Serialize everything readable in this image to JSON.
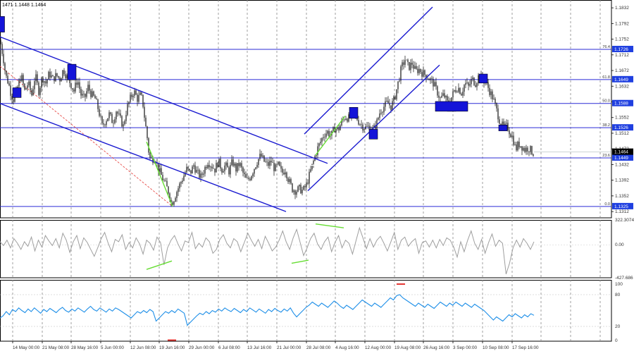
{
  "ohlc_header": "1471 1.1448 1.1464",
  "chart_data": [
    {
      "type": "candlestick",
      "title": "",
      "price_ticks": [
        "1.1832",
        "1.1792",
        "1.1752",
        "1.1712",
        "1.1672",
        "1.1632",
        "1.1592",
        "1.1552",
        "1.1512",
        "1.1472",
        "1.1432",
        "1.1392",
        "1.1352",
        "1.1312"
      ],
      "ylim": [
        1.1296,
        1.1852
      ],
      "x_ticks": [
        "14 May 00:00",
        "21 May 08:00",
        "28 May 16:00",
        "5 Jun 00:00",
        "12 Jun 08:00",
        "19 Jun 16:00",
        "29 Jun 00:00",
        "6 Jul 08:00",
        "13 Jul 16:00",
        "21 Jul 00:00",
        "28 Jul 08:00",
        "4 Aug 16:00",
        "12 Aug 00:00",
        "19 Aug 08:00",
        "26 Aug 16:00",
        "3 Sep 00:00",
        "10 Sep 08:00",
        "17 Sep 16:00"
      ],
      "fib_levels": [
        {
          "pct": "76.4",
          "price": "1.1726",
          "value": 1.1726
        },
        {
          "pct": "61.8",
          "price": "1.1649",
          "value": 1.1649
        },
        {
          "pct": "50.0",
          "price": "1.1588",
          "value": 1.1588
        },
        {
          "pct": "38.2",
          "price": "1.1526",
          "value": 1.1526
        },
        {
          "pct": "23.6",
          "price": "1.1449",
          "value": 1.1449
        },
        {
          "pct": "0.0",
          "price": "1.1325",
          "value": 1.1325
        }
      ],
      "current_price": "1.1464",
      "close_path": [
        [
          0,
          1.175
        ],
        [
          2,
          1.173
        ],
        [
          5,
          1.17
        ],
        [
          8,
          1.166
        ],
        [
          12,
          1.164
        ],
        [
          16,
          1.161
        ],
        [
          20,
          1.1595
        ],
        [
          25,
          1.163
        ],
        [
          30,
          1.166
        ],
        [
          35,
          1.162
        ],
        [
          40,
          1.164
        ],
        [
          45,
          1.161
        ],
        [
          50,
          1.166
        ],
        [
          55,
          1.162
        ],
        [
          60,
          1.1655
        ],
        [
          65,
          1.164
        ],
        [
          70,
          1.1665
        ],
        [
          75,
          1.165
        ],
        [
          80,
          1.166
        ],
        [
          85,
          1.165
        ],
        [
          90,
          1.1675
        ],
        [
          95,
          1.1655
        ],
        [
          100,
          1.164
        ],
        [
          105,
          1.162
        ],
        [
          110,
          1.165
        ],
        [
          115,
          1.161
        ],
        [
          120,
          1.16
        ],
        [
          125,
          1.163
        ],
        [
          130,
          1.161
        ],
        [
          135,
          1.16
        ],
        [
          140,
          1.157
        ],
        [
          145,
          1.153
        ],
        [
          150,
          1.1545
        ],
        [
          155,
          1.156
        ],
        [
          160,
          1.154
        ],
        [
          165,
          1.157
        ],
        [
          170,
          1.155
        ],
        [
          175,
          1.153
        ],
        [
          180,
          1.1575
        ],
        [
          185,
          1.16
        ],
        [
          190,
          1.162
        ],
        [
          195,
          1.16
        ],
        [
          200,
          1.161
        ],
        [
          203,
          1.1585
        ],
        [
          206,
          1.154
        ],
        [
          209,
          1.15
        ],
        [
          212,
          1.145
        ],
        [
          215,
          1.1445
        ],
        [
          220,
          1.145
        ],
        [
          225,
          1.142
        ],
        [
          230,
          1.14
        ],
        [
          235,
          1.138
        ],
        [
          240,
          1.136
        ],
        [
          243,
          1.1335
        ],
        [
          246,
          1.134
        ],
        [
          250,
          1.136
        ],
        [
          255,
          1.138
        ],
        [
          260,
          1.14
        ],
        [
          265,
          1.142
        ],
        [
          270,
          1.141
        ],
        [
          275,
          1.143
        ],
        [
          280,
          1.141
        ],
        [
          285,
          1.14
        ],
        [
          290,
          1.142
        ],
        [
          295,
          1.144
        ],
        [
          300,
          1.143
        ],
        [
          305,
          1.142
        ],
        [
          310,
          1.144
        ],
        [
          315,
          1.142
        ],
        [
          320,
          1.143
        ],
        [
          325,
          1.1415
        ],
        [
          330,
          1.144
        ],
        [
          335,
          1.142
        ],
        [
          340,
          1.1435
        ],
        [
          345,
          1.141
        ],
        [
          350,
          1.139
        ],
        [
          355,
          1.14
        ],
        [
          360,
          1.142
        ],
        [
          365,
          1.144
        ],
        [
          370,
          1.1455
        ],
        [
          375,
          1.144
        ],
        [
          380,
          1.143
        ],
        [
          385,
          1.144
        ],
        [
          390,
          1.142
        ],
        [
          395,
          1.143
        ],
        [
          400,
          1.141
        ],
        [
          405,
          1.142
        ],
        [
          410,
          1.139
        ],
        [
          415,
          1.137
        ],
        [
          420,
          1.1365
        ],
        [
          425,
          1.137
        ],
        [
          430,
          1.1365
        ],
        [
          435,
          1.138
        ],
        [
          440,
          1.141
        ],
        [
          445,
          1.144
        ],
        [
          450,
          1.147
        ],
        [
          455,
          1.149
        ],
        [
          460,
          1.151
        ],
        [
          465,
          1.1515
        ],
        [
          470,
          1.1505
        ],
        [
          475,
          1.1525
        ],
        [
          480,
          1.152
        ],
        [
          485,
          1.154
        ],
        [
          490,
          1.1555
        ],
        [
          495,
          1.155
        ],
        [
          500,
          1.1565
        ],
        [
          505,
          1.1555
        ],
        [
          510,
          1.154
        ],
        [
          515,
          1.153
        ],
        [
          520,
          1.1525
        ],
        [
          525,
          1.153
        ],
        [
          530,
          1.152
        ],
        [
          535,
          1.154
        ],
        [
          540,
          1.157
        ],
        [
          545,
          1.158
        ],
        [
          550,
          1.159
        ],
        [
          555,
          1.158
        ],
        [
          560,
          1.16
        ],
        [
          565,
          1.164
        ],
        [
          570,
          1.168
        ],
        [
          575,
          1.17
        ],
        [
          580,
          1.168
        ],
        [
          585,
          1.169
        ],
        [
          590,
          1.167
        ],
        [
          595,
          1.1675
        ],
        [
          600,
          1.1665
        ],
        [
          605,
          1.166
        ],
        [
          610,
          1.165
        ],
        [
          615,
          1.164
        ],
        [
          620,
          1.162
        ],
        [
          625,
          1.16
        ],
        [
          630,
          1.161
        ],
        [
          635,
          1.159
        ],
        [
          640,
          1.16
        ],
        [
          645,
          1.162
        ],
        [
          650,
          1.163
        ],
        [
          655,
          1.1615
        ],
        [
          660,
          1.164
        ],
        [
          665,
          1.163
        ],
        [
          670,
          1.165
        ],
        [
          675,
          1.164
        ],
        [
          680,
          1.166
        ],
        [
          685,
          1.165
        ],
        [
          690,
          1.164
        ],
        [
          695,
          1.162
        ],
        [
          700,
          1.16
        ],
        [
          705,
          1.157
        ],
        [
          710,
          1.154
        ],
        [
          715,
          1.1525
        ],
        [
          720,
          1.153
        ],
        [
          725,
          1.151
        ],
        [
          728,
          1.15
        ],
        [
          732,
          1.147
        ],
        [
          736,
          1.1485
        ],
        [
          740,
          1.148
        ],
        [
          745,
          1.147
        ],
        [
          750,
          1.1475
        ],
        [
          755,
          1.1465
        ],
        [
          758,
          1.146
        ]
      ],
      "boxes": [
        {
          "x": 0.5,
          "hi": 1.181,
          "lo": 1.177
        },
        {
          "x": 24,
          "hi": 1.1628,
          "lo": 1.1603
        },
        {
          "x": 102,
          "hi": 1.1688,
          "lo": 1.1648
        },
        {
          "x": 502,
          "hi": 1.1578,
          "lo": 1.155
        },
        {
          "x": 530,
          "hi": 1.1522,
          "lo": 1.1497
        },
        {
          "x": 641,
          "hi": 1.159,
          "lo": 1.1568
        },
        {
          "x": 686,
          "hi": 1.1663,
          "lo": 1.164
        },
        {
          "x": 714,
          "hi": 1.1533,
          "lo": 1.1518
        }
      ],
      "boxes_wide": [
        {
          "x1": 618,
          "x2": 664,
          "hi": 1.1593,
          "lo": 1.1568
        }
      ],
      "trend_lines": [
        {
          "x1": 0,
          "p1": 1.1758,
          "x2": 465,
          "p2": 1.1435
        },
        {
          "x1": 0,
          "p1": 1.1588,
          "x2": 406,
          "p2": 1.1312
        },
        {
          "x1": 432,
          "p1": 1.151,
          "x2": 614,
          "p2": 1.1834
        },
        {
          "x1": 437,
          "p1": 1.1365,
          "x2": 624,
          "p2": 1.1686
        }
      ],
      "red_dashed": {
        "x1": 0,
        "p1": 1.1683,
        "x2": 245,
        "p2": 1.1325
      },
      "green_lines": [
        {
          "x1": 208,
          "p1": 1.149,
          "x2": 245,
          "p2": 1.1325
        },
        {
          "x1": 448,
          "p1": 1.1456,
          "x2": 490,
          "p2": 1.1556
        }
      ],
      "white_line": {
        "x1": 418,
        "p1": 1.143,
        "x2": 470,
        "p2": 1.143
      }
    },
    {
      "type": "line",
      "name": "oscillator",
      "ticks": [
        "322.3074",
        "0.00",
        "-427.686"
      ],
      "ylim": [
        -427.686,
        322.3074
      ],
      "values": [
        40,
        -10,
        60,
        -40,
        80,
        20,
        -60,
        40,
        -20,
        100,
        -80,
        60,
        -30,
        120,
        50,
        -10,
        80,
        -40,
        150,
        60,
        -100,
        40,
        120,
        -50,
        90,
        30,
        -60,
        -150,
        -40,
        80,
        160,
        20,
        -90,
        70,
        40,
        130,
        -60,
        30,
        -40,
        90,
        10,
        -120,
        60,
        20,
        -70,
        100,
        30,
        -260,
        -40,
        60,
        120,
        10,
        -80,
        50,
        30,
        160,
        -50,
        20,
        -30,
        90,
        40,
        -110,
        -60,
        70,
        130,
        20,
        -40,
        80,
        40,
        -90,
        30,
        150,
        60,
        -20,
        70,
        -50,
        110,
        20,
        -80,
        -30,
        60,
        180,
        40,
        -60,
        90,
        200,
        30,
        -140,
        -40,
        80,
        150,
        10,
        -60,
        40,
        100,
        -90,
        30,
        120,
        -40,
        60,
        20,
        -120,
        50,
        220,
        90,
        -50,
        80,
        -30,
        60,
        110,
        20,
        -80,
        40,
        160,
        -60,
        60,
        100,
        -20,
        40,
        80,
        -110,
        30,
        50,
        -30,
        60,
        -40,
        70,
        -10,
        90,
        60,
        -30,
        -160,
        40,
        -90,
        60,
        180,
        20,
        -60,
        70,
        -110,
        30,
        140,
        -20,
        60,
        20,
        -380,
        -240,
        -40,
        60,
        -30,
        80,
        20,
        -60,
        40
      ],
      "green_segments": [
        {
          "x1": 208,
          "v1": -320,
          "x2": 244,
          "v2": -210
        },
        {
          "x1": 414,
          "v1": -240,
          "x2": 438,
          "v2": -200
        },
        {
          "x1": 448,
          "v1": 270,
          "x2": 488,
          "v2": 220
        }
      ]
    },
    {
      "type": "line",
      "name": "rsi",
      "ticks": [
        "100",
        "80",
        "20",
        "0"
      ],
      "ylim": [
        0,
        100
      ],
      "values": [
        36,
        40,
        48,
        42,
        52,
        48,
        55,
        50,
        46,
        53,
        48,
        55,
        50,
        45,
        52,
        48,
        54,
        50,
        46,
        52,
        56,
        50,
        47,
        53,
        49,
        55,
        51,
        47,
        53,
        58,
        52,
        49,
        55,
        51,
        47,
        53,
        49,
        55,
        52,
        48,
        44,
        40,
        36,
        42,
        48,
        45,
        50,
        46,
        52,
        48,
        30,
        36,
        42,
        48,
        45,
        50,
        46,
        53,
        49,
        45,
        22,
        28,
        34,
        40,
        45,
        42,
        48,
        44,
        50,
        47,
        53,
        49,
        55,
        51,
        48,
        54,
        50,
        46,
        52,
        48,
        55,
        51,
        47,
        53,
        49,
        45,
        52,
        48,
        54,
        50,
        47,
        53,
        49,
        55,
        45,
        38,
        44,
        50,
        56,
        60,
        66,
        62,
        58,
        64,
        60,
        56,
        62,
        68,
        64,
        58,
        54,
        60,
        56,
        52,
        58,
        64,
        70,
        66,
        62,
        58,
        64,
        60,
        56,
        62,
        68,
        74,
        70,
        78,
        80,
        74,
        70,
        66,
        62,
        58,
        64,
        60,
        56,
        62,
        58,
        54,
        60,
        66,
        62,
        58,
        64,
        60,
        66,
        62,
        58,
        64,
        60,
        56,
        62,
        58,
        54,
        50,
        44,
        38,
        32,
        38,
        34,
        30,
        36,
        42,
        38,
        44,
        40,
        36,
        42,
        38,
        44,
        41
      ],
      "red_markers": [
        {
          "x": 244,
          "v": -6
        },
        {
          "x": 569,
          "v": 100
        }
      ]
    }
  ]
}
